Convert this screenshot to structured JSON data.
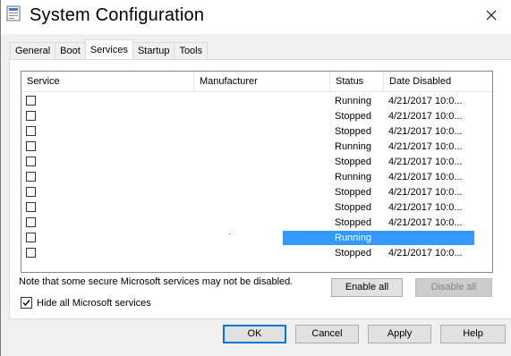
{
  "window": {
    "title": "System Configuration"
  },
  "tabs": [
    {
      "label": "General"
    },
    {
      "label": "Boot"
    },
    {
      "label": "Services"
    },
    {
      "label": "Startup"
    },
    {
      "label": "Tools"
    }
  ],
  "active_tab": "Services",
  "services_list": {
    "columns": [
      "Service",
      "Manufacturer",
      "Status",
      "Date Disabled"
    ],
    "rows": [
      {
        "status": "Running",
        "date": "4/21/2017 10:0...",
        "checked": false
      },
      {
        "status": "Stopped",
        "date": "4/21/2017 10:0...",
        "checked": false
      },
      {
        "status": "Stopped",
        "date": "4/21/2017 10:0...",
        "checked": false
      },
      {
        "status": "Running",
        "date": "4/21/2017 10:0...",
        "checked": false
      },
      {
        "status": "Stopped",
        "date": "4/21/2017 10:0...",
        "checked": false
      },
      {
        "status": "Running",
        "date": "4/21/2017 10:0...",
        "checked": false
      },
      {
        "status": "Stopped",
        "date": "4/21/2017 10:0...",
        "checked": false
      },
      {
        "status": "Stopped",
        "date": "4/21/2017 10:0...",
        "checked": false
      },
      {
        "status": "Stopped",
        "date": "4/21/2017 10:0...",
        "checked": false
      },
      {
        "status": "Running",
        "date": "",
        "checked": false,
        "selected": true
      },
      {
        "status": "Stopped",
        "date": "4/21/2017 10:0...",
        "checked": false
      }
    ]
  },
  "note": "Note that some secure Microsoft services may not be disabled.",
  "enable_all_label": "Enable all",
  "disable_all_label": "Disable all",
  "hide_ms_label": "Hide all Microsoft services",
  "hide_ms_checked": true,
  "footer": {
    "ok_label": "OK",
    "cancel_label": "Cancel",
    "apply_label": "Apply",
    "help_label": "Help"
  },
  "colors": {
    "selection": "#3399ff",
    "window_bg": "#f0f0f0",
    "default_button_border": "#0078d7"
  },
  "icons": {
    "app": "system-configuration-icon",
    "close": "close-icon",
    "checkmark": "checkmark-icon"
  }
}
